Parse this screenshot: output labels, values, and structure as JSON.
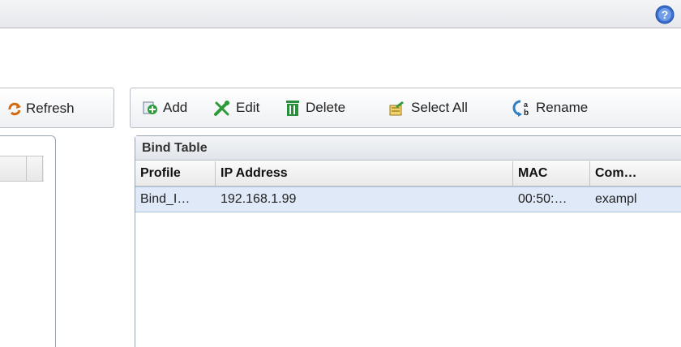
{
  "toolbar_left": {
    "refresh_label": "Refresh"
  },
  "toolbar_right": {
    "add_label": "Add",
    "edit_label": "Edit",
    "delete_label": "Delete",
    "select_all_label": "Select All",
    "rename_label": "Rename"
  },
  "grid": {
    "title": "Bind Table",
    "columns": [
      "Profile",
      "IP Address",
      "MAC",
      "Com…"
    ],
    "rows": [
      [
        "Bind_I…",
        "192.168.1.99",
        "00:50:…",
        "exampl"
      ]
    ]
  },
  "colors": {
    "selected_row": "#dfe9f7",
    "add_icon": "#2e9b3b",
    "edit_icon": "#2d9a3a",
    "delete_icon": "#2a8f3a",
    "help_icon": "#3a6fd0"
  }
}
